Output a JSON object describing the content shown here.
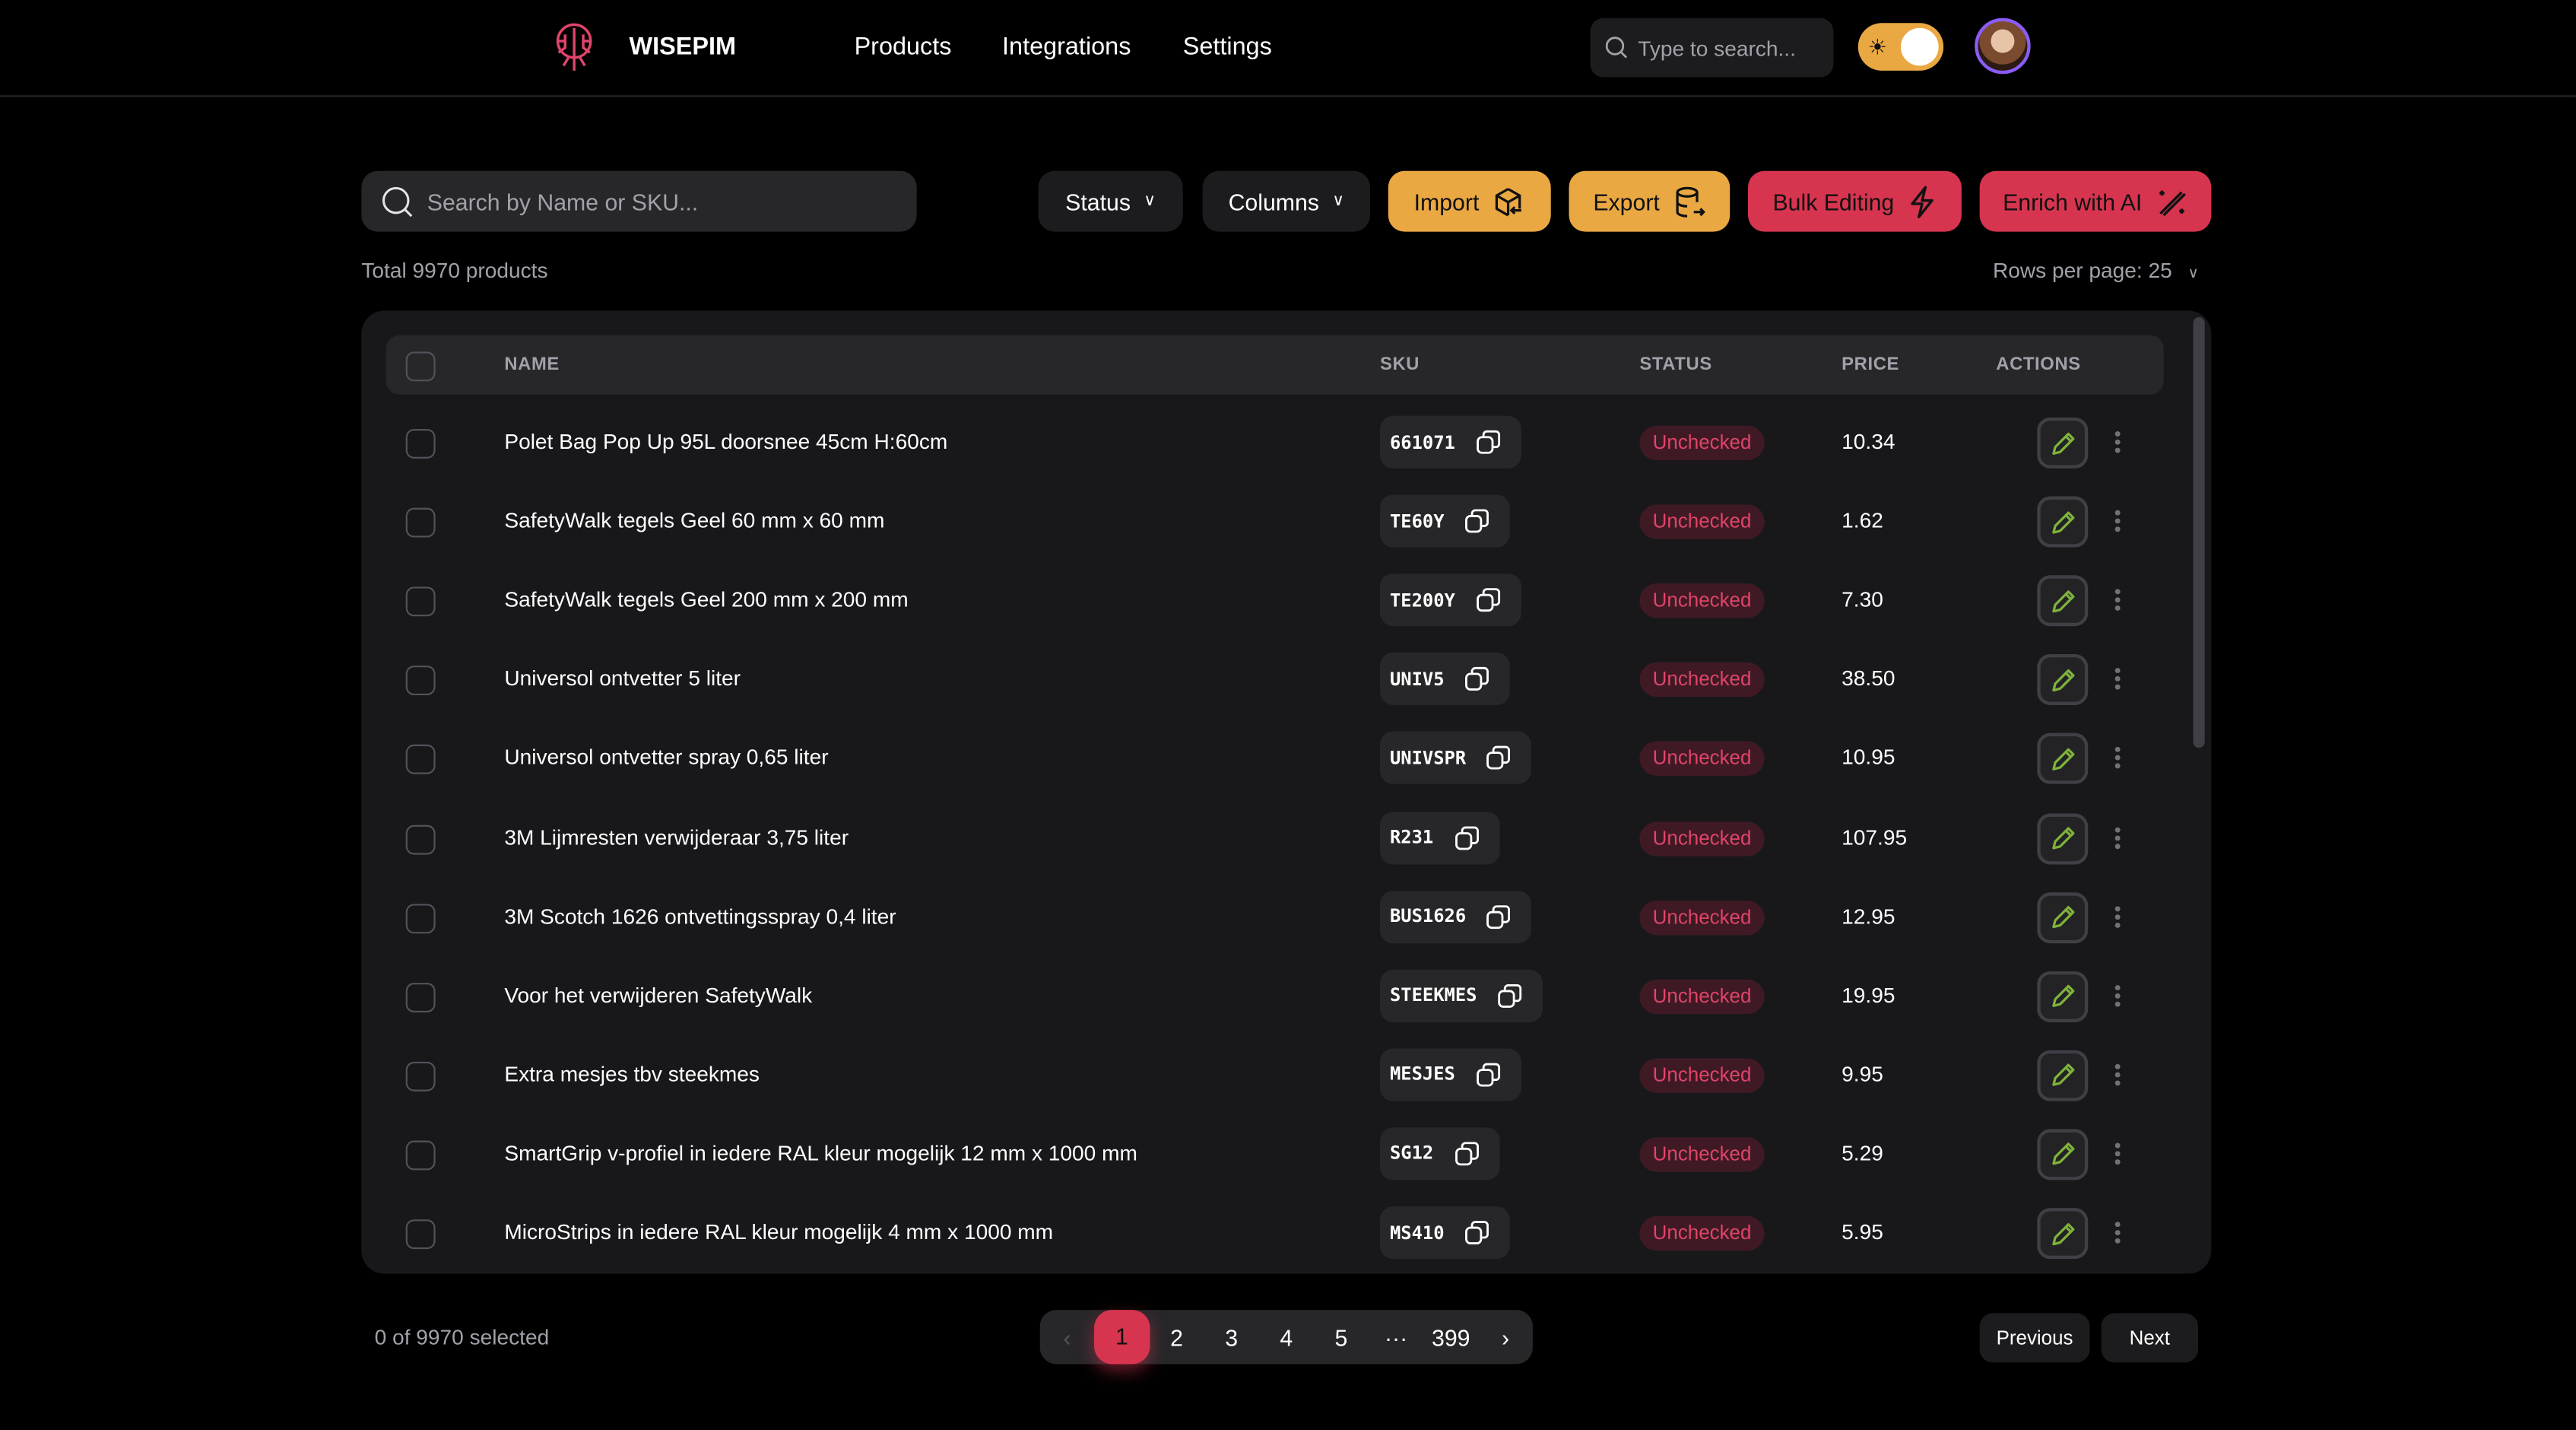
{
  "header": {
    "brand": "WISEPIM",
    "nav": [
      "Products",
      "Integrations",
      "Settings"
    ],
    "search_placeholder": "Type to search..."
  },
  "toolbar": {
    "search_placeholder": "Search by Name or SKU...",
    "status": "Status",
    "columns": "Columns",
    "import": "Import",
    "export": "Export",
    "bulk": "Bulk Editing",
    "enrich": "Enrich with AI"
  },
  "summary": {
    "total": "Total 9970 products",
    "rows_per_page": "Rows per page: 25"
  },
  "table": {
    "headers": {
      "name": "NAME",
      "sku": "SKU",
      "status": "STATUS",
      "price": "PRICE",
      "actions": "ACTIONS"
    },
    "rows": [
      {
        "name": "Polet Bag Pop Up 95L doorsnee 45cm H:60cm",
        "sku": "661071",
        "status": "Unchecked",
        "price": "10.34"
      },
      {
        "name": "SafetyWalk tegels Geel 60 mm x 60 mm",
        "sku": "TE60Y",
        "status": "Unchecked",
        "price": "1.62"
      },
      {
        "name": "SafetyWalk tegels Geel 200 mm x 200 mm",
        "sku": "TE200Y",
        "status": "Unchecked",
        "price": "7.30"
      },
      {
        "name": "Universol ontvetter 5 liter",
        "sku": "UNIV5",
        "status": "Unchecked",
        "price": "38.50"
      },
      {
        "name": "Universol ontvetter spray 0,65 liter",
        "sku": "UNIVSPR",
        "status": "Unchecked",
        "price": "10.95"
      },
      {
        "name": "3M Lijmresten verwijderaar 3,75 liter",
        "sku": "R231",
        "status": "Unchecked",
        "price": "107.95"
      },
      {
        "name": "3M Scotch 1626 ontvettingsspray 0,4 liter",
        "sku": "BUS1626",
        "status": "Unchecked",
        "price": "12.95"
      },
      {
        "name": "Voor het verwijderen SafetyWalk",
        "sku": "STEEKMES",
        "status": "Unchecked",
        "price": "19.95"
      },
      {
        "name": "Extra mesjes tbv steekmes",
        "sku": "MESJES",
        "status": "Unchecked",
        "price": "9.95"
      },
      {
        "name": "SmartGrip v-profiel in iedere RAL kleur mogelijk 12 mm x 1000 mm",
        "sku": "SG12",
        "status": "Unchecked",
        "price": "5.29"
      },
      {
        "name": "MicroStrips in iedere RAL kleur mogelijk 4 mm x 1000 mm",
        "sku": "MS410",
        "status": "Unchecked",
        "price": "5.95"
      }
    ]
  },
  "footer": {
    "selected": "0 of 9970 selected",
    "pages": [
      "1",
      "2",
      "3",
      "4",
      "5",
      "···",
      "399"
    ],
    "previous": "Previous",
    "next": "Next"
  },
  "colors": {
    "accent_red": "#d7344f",
    "accent_orange": "#eaa843",
    "edit_green": "#7fb33a"
  }
}
